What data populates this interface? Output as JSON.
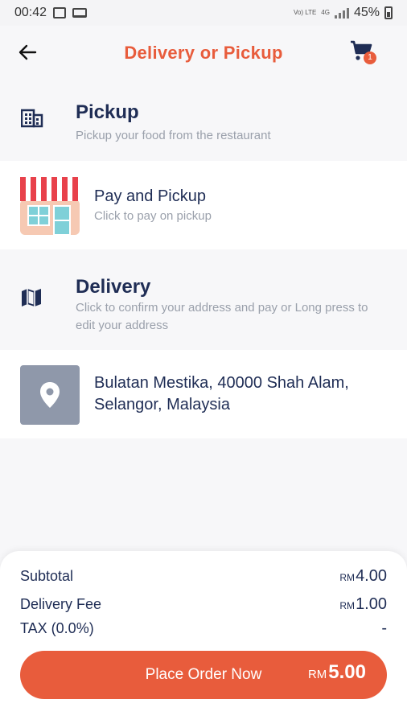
{
  "status_bar": {
    "time": "00:42",
    "network_label": "Vo) LTE",
    "network_gen": "4G",
    "battery": "45%"
  },
  "header": {
    "title": "Delivery or Pickup",
    "cart_count": "1"
  },
  "pickup_section": {
    "title": "Pickup",
    "subtitle": "Pickup your food from the restaurant"
  },
  "pickup_option": {
    "title": "Pay and Pickup",
    "subtitle": "Click to pay on pickup"
  },
  "delivery_section": {
    "title": "Delivery",
    "subtitle": "Click to confirm your address and pay or Long press to edit your address"
  },
  "delivery_option": {
    "address": "Bulatan Mestika, 40000 Shah Alam, Selangor, Malaysia"
  },
  "summary": {
    "subtotal_label": "Subtotal",
    "subtotal_currency": "RM",
    "subtotal_value": "4.00",
    "delivery_fee_label": "Delivery Fee",
    "delivery_fee_currency": "RM",
    "delivery_fee_value": "1.00",
    "tax_label": "TAX (0.0%)",
    "tax_value": "-"
  },
  "place_order": {
    "label": "Place Order Now",
    "currency": "RM",
    "total": "5.00"
  },
  "colors": {
    "accent": "#e85c3c",
    "navy": "#1f2d55",
    "muted": "#9aa0ab",
    "map_tile": "#8f98aa"
  }
}
